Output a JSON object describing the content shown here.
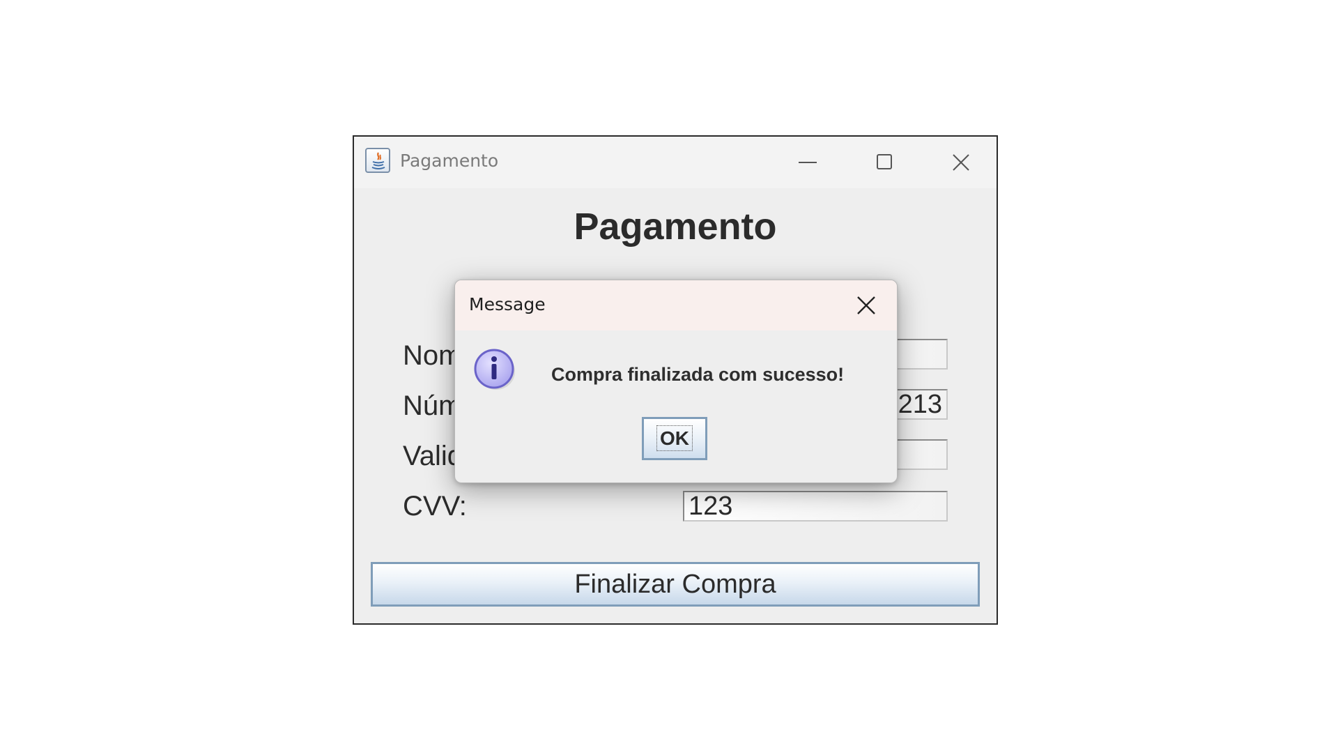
{
  "window": {
    "title": "Pagamento",
    "icon": "java-icon",
    "controls": [
      "minimize-icon",
      "maximize-icon",
      "close-icon"
    ]
  },
  "form": {
    "heading": "Pagamento",
    "fields": [
      {
        "label": "Nome do Titular:",
        "value": ""
      },
      {
        "label": "Número do Cartão:",
        "value": "213"
      },
      {
        "label": "Validade:",
        "value": ""
      },
      {
        "label": "CVV:",
        "value": "123"
      }
    ],
    "submit_label": "Finalizar Compra"
  },
  "dialog": {
    "title": "Message",
    "icon": "info-icon",
    "message": "Compra finalizada com sucesso!",
    "ok_label": "OK"
  },
  "colors": {
    "window_bg": "#eeeeee",
    "dialog_title_bg": "#f9efed",
    "button_border": "#7f9db9",
    "info_icon_fill": "#b9b4f3"
  }
}
